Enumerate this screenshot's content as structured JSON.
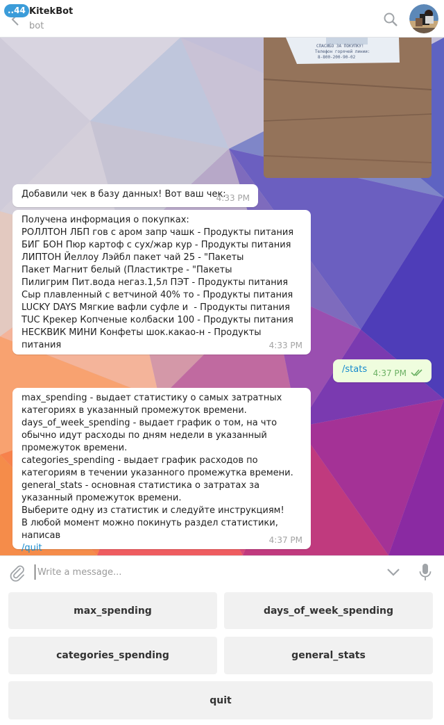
{
  "header": {
    "unread_count": "..44",
    "title": "KitekBot",
    "subtitle": "bot"
  },
  "messages": [
    {
      "kind": "text",
      "direction": "in",
      "text": "Добавили чек в базу данных! Вот ваш чек:",
      "time": "4:33 PM"
    },
    {
      "kind": "text",
      "direction": "in",
      "text": "Получена информация о покупках:\nРОЛЛТОН ЛБП гов с аром запр чашк - Продукты питания\nБИГ БОН Пюр картоф с сух/жар кур - Продукты питания\nЛИПТОН Йеллоу Лэйбл пакет чай 25 - \"Пакеты\nПакет Магнит белый (Пластиктре - \"Пакеты\nПилигрим Пит.вода негаз.1,5л ПЭТ - Продукты питания\nСыр плавленный с ветчиной 40% то - Продукты питания\nLUCKY DAYS Мягкие вафли суфле и  - Продукты питания\nTUC Крекер Копченые колбаски 100 - Продукты питания\nНЕСКВИК МИНИ Конфеты шок.какао-н - Продукты питания",
      "time": "4:33 PM"
    },
    {
      "kind": "text",
      "direction": "out",
      "text": "/stats",
      "time": "4:37 PM"
    },
    {
      "kind": "text",
      "direction": "in",
      "text": "max_spending - выдает статистику о самых затратных категориях в указанный промежуток времени.\ndays_of_week_spending - выдает график о том, на что обычно идут расходы по дням недели в указанный промежуток времени.\ncategories_spending - выдает график расходов по категориям в течении указанного промежутка времени.\ngeneral_stats - основная статистика о затратах за указанный промежуток времени.\nВыберите одну из статистик и следуйте инструкциям!\nВ любой момент можно покинуть раздел статистики, написав",
      "link": "/quit",
      "time": "4:37 PM"
    }
  ],
  "receipt_photo": {
    "line1": "СПАСИБО ЗА ПОКУПКУ!",
    "line2": "Телефон горячей линии:",
    "line3": "8-800-200-90-02"
  },
  "input": {
    "placeholder": "Write a message..."
  },
  "keyboard": {
    "buttons": [
      "max_spending",
      "days_of_week_spending",
      "categories_spending",
      "general_stats",
      "quit"
    ]
  },
  "icons": {
    "back": "back-arrow-icon",
    "search": "search-icon",
    "attach": "paperclip-icon",
    "keyboard_toggle": "chevron-down-icon",
    "voice": "microphone-icon",
    "read_status": "double-check-icon"
  },
  "colors": {
    "link": "#168acd",
    "badge": "#3b9cd9",
    "outgoing_bubble": "#effdde",
    "read_check": "#6cb164"
  }
}
